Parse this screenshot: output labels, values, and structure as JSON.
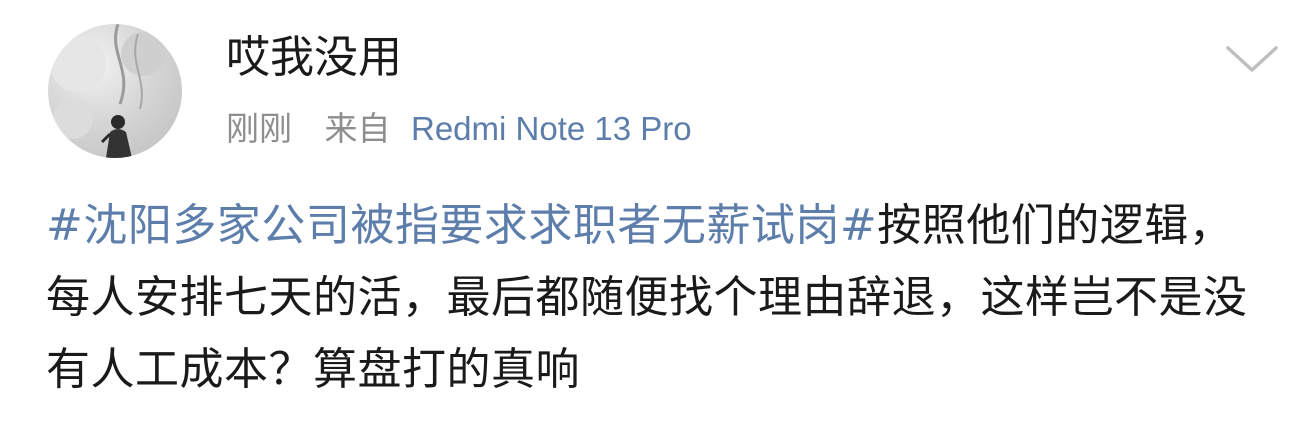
{
  "post": {
    "user": {
      "name": "哎我没用"
    },
    "meta": {
      "time": "刚刚",
      "from_label": "来自",
      "device": "Redmi Note 13 Pro"
    },
    "content": {
      "hashtag": "#沈阳多家公司被指要求求职者无薪试岗#",
      "text": "按照他们的逻辑，每人安排七天的活，最后都随便找个理由辞退，这样岂不是没有人工成本？算盘打的真响"
    }
  },
  "colors": {
    "link_blue": "#5d7dab",
    "meta_gray": "#8e8e8e",
    "text_dark": "#1a1a1a"
  },
  "icons": {
    "menu_toggle": "chevron-down-icon"
  }
}
